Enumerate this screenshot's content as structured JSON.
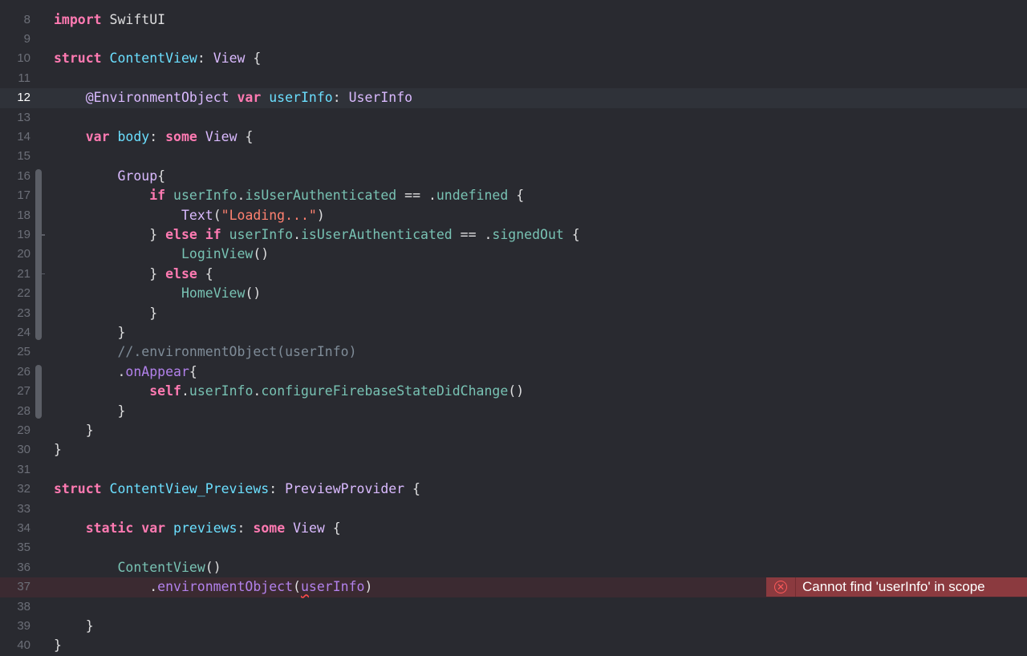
{
  "editor": {
    "language": "Swift",
    "colors": {
      "background": "#292a30",
      "current_line": "#2f3239",
      "error_line": "#3b2a31",
      "keyword": "#ff7ab2",
      "type": "#dabaff",
      "declaration": "#6bdfff",
      "property": "#78c2b3",
      "function": "#b281eb",
      "string": "#ff8170",
      "comment": "#7f8c98",
      "plain": "#dfdfe0",
      "error_badge": "#8b3a3f"
    },
    "top_partial_line_number": "7",
    "current_line_number": "12",
    "lines": [
      {
        "n": "8",
        "tokens": [
          {
            "t": "import",
            "c": "kw"
          },
          {
            "t": " SwiftUI",
            "c": ""
          }
        ]
      },
      {
        "n": "9",
        "tokens": []
      },
      {
        "n": "10",
        "tokens": [
          {
            "t": "struct",
            "c": "kw"
          },
          {
            "t": " ",
            "c": ""
          },
          {
            "t": "ContentView",
            "c": "decl"
          },
          {
            "t": ": ",
            "c": ""
          },
          {
            "t": "View",
            "c": "type"
          },
          {
            "t": " {",
            "c": ""
          }
        ]
      },
      {
        "n": "11",
        "tokens": []
      },
      {
        "n": "12",
        "tokens": [
          {
            "t": "    ",
            "c": ""
          },
          {
            "t": "@EnvironmentObject",
            "c": "type"
          },
          {
            "t": " ",
            "c": ""
          },
          {
            "t": "var",
            "c": "kw"
          },
          {
            "t": " ",
            "c": ""
          },
          {
            "t": "userInfo",
            "c": "decl"
          },
          {
            "t": ": ",
            "c": ""
          },
          {
            "t": "UserInfo",
            "c": "type"
          }
        ]
      },
      {
        "n": "13",
        "tokens": []
      },
      {
        "n": "14",
        "tokens": [
          {
            "t": "    ",
            "c": ""
          },
          {
            "t": "var",
            "c": "kw"
          },
          {
            "t": " ",
            "c": ""
          },
          {
            "t": "body",
            "c": "decl"
          },
          {
            "t": ": ",
            "c": ""
          },
          {
            "t": "some",
            "c": "kw"
          },
          {
            "t": " ",
            "c": ""
          },
          {
            "t": "View",
            "c": "type"
          },
          {
            "t": " {",
            "c": ""
          }
        ]
      },
      {
        "n": "15",
        "tokens": []
      },
      {
        "n": "16",
        "tokens": [
          {
            "t": "        ",
            "c": ""
          },
          {
            "t": "Group",
            "c": "type"
          },
          {
            "t": "{",
            "c": ""
          }
        ]
      },
      {
        "n": "17",
        "tokens": [
          {
            "t": "            ",
            "c": ""
          },
          {
            "t": "if",
            "c": "kw"
          },
          {
            "t": " ",
            "c": ""
          },
          {
            "t": "userInfo",
            "c": "prop"
          },
          {
            "t": ".",
            "c": ""
          },
          {
            "t": "isUserAuthenticated",
            "c": "prop"
          },
          {
            "t": " == .",
            "c": ""
          },
          {
            "t": "undefined",
            "c": "prop"
          },
          {
            "t": " {",
            "c": ""
          }
        ]
      },
      {
        "n": "18",
        "tokens": [
          {
            "t": "                ",
            "c": ""
          },
          {
            "t": "Text",
            "c": "type"
          },
          {
            "t": "(",
            "c": ""
          },
          {
            "t": "\"Loading...\"",
            "c": "str"
          },
          {
            "t": ")",
            "c": ""
          }
        ]
      },
      {
        "n": "19",
        "tokens": [
          {
            "t": "            } ",
            "c": ""
          },
          {
            "t": "else",
            "c": "kw"
          },
          {
            "t": " ",
            "c": ""
          },
          {
            "t": "if",
            "c": "kw"
          },
          {
            "t": " ",
            "c": ""
          },
          {
            "t": "userInfo",
            "c": "prop"
          },
          {
            "t": ".",
            "c": ""
          },
          {
            "t": "isUserAuthenticated",
            "c": "prop"
          },
          {
            "t": " == .",
            "c": ""
          },
          {
            "t": "signedOut",
            "c": "prop"
          },
          {
            "t": " {",
            "c": ""
          }
        ]
      },
      {
        "n": "20",
        "tokens": [
          {
            "t": "                ",
            "c": ""
          },
          {
            "t": "LoginView",
            "c": "prop"
          },
          {
            "t": "()",
            "c": ""
          }
        ]
      },
      {
        "n": "21",
        "tokens": [
          {
            "t": "            } ",
            "c": ""
          },
          {
            "t": "else",
            "c": "kw"
          },
          {
            "t": " {",
            "c": ""
          }
        ]
      },
      {
        "n": "22",
        "tokens": [
          {
            "t": "                ",
            "c": ""
          },
          {
            "t": "HomeView",
            "c": "prop"
          },
          {
            "t": "()",
            "c": ""
          }
        ]
      },
      {
        "n": "23",
        "tokens": [
          {
            "t": "            }",
            "c": ""
          }
        ]
      },
      {
        "n": "24",
        "tokens": [
          {
            "t": "        }",
            "c": ""
          }
        ]
      },
      {
        "n": "25",
        "tokens": [
          {
            "t": "        ",
            "c": ""
          },
          {
            "t": "//.environmentObject(userInfo)",
            "c": "cmt"
          }
        ]
      },
      {
        "n": "26",
        "tokens": [
          {
            "t": "        .",
            "c": ""
          },
          {
            "t": "onAppear",
            "c": "fn"
          },
          {
            "t": "{",
            "c": ""
          }
        ]
      },
      {
        "n": "27",
        "tokens": [
          {
            "t": "            ",
            "c": ""
          },
          {
            "t": "self",
            "c": "kw"
          },
          {
            "t": ".",
            "c": ""
          },
          {
            "t": "userInfo",
            "c": "prop"
          },
          {
            "t": ".",
            "c": ""
          },
          {
            "t": "configureFirebaseStateDidChange",
            "c": "prop"
          },
          {
            "t": "()",
            "c": ""
          }
        ]
      },
      {
        "n": "28",
        "tokens": [
          {
            "t": "        }",
            "c": ""
          }
        ]
      },
      {
        "n": "29",
        "tokens": [
          {
            "t": "    }",
            "c": ""
          }
        ]
      },
      {
        "n": "30",
        "tokens": [
          {
            "t": "}",
            "c": ""
          }
        ]
      },
      {
        "n": "31",
        "tokens": []
      },
      {
        "n": "32",
        "tokens": [
          {
            "t": "struct",
            "c": "kw"
          },
          {
            "t": " ",
            "c": ""
          },
          {
            "t": "ContentView_Previews",
            "c": "decl"
          },
          {
            "t": ": ",
            "c": ""
          },
          {
            "t": "PreviewProvider",
            "c": "type"
          },
          {
            "t": " {",
            "c": ""
          }
        ]
      },
      {
        "n": "33",
        "tokens": []
      },
      {
        "n": "34",
        "tokens": [
          {
            "t": "    ",
            "c": ""
          },
          {
            "t": "static",
            "c": "kw"
          },
          {
            "t": " ",
            "c": ""
          },
          {
            "t": "var",
            "c": "kw"
          },
          {
            "t": " ",
            "c": ""
          },
          {
            "t": "previews",
            "c": "decl"
          },
          {
            "t": ": ",
            "c": ""
          },
          {
            "t": "some",
            "c": "kw"
          },
          {
            "t": " ",
            "c": ""
          },
          {
            "t": "View",
            "c": "type"
          },
          {
            "t": " {",
            "c": ""
          }
        ]
      },
      {
        "n": "35",
        "tokens": []
      },
      {
        "n": "36",
        "tokens": [
          {
            "t": "        ",
            "c": ""
          },
          {
            "t": "ContentView",
            "c": "prop"
          },
          {
            "t": "()",
            "c": ""
          }
        ]
      },
      {
        "n": "37",
        "tokens": [
          {
            "t": "            .",
            "c": ""
          },
          {
            "t": "environmentObject",
            "c": "fn"
          },
          {
            "t": "(",
            "c": ""
          },
          {
            "t": "u",
            "c": "fn err-word"
          },
          {
            "t": "serInfo",
            "c": "fn"
          },
          {
            "t": ")",
            "c": ""
          }
        ]
      },
      {
        "n": "38",
        "tokens": []
      },
      {
        "n": "39",
        "tokens": [
          {
            "t": "    }",
            "c": ""
          }
        ]
      },
      {
        "n": "40",
        "tokens": [
          {
            "t": "}",
            "c": ""
          }
        ]
      }
    ]
  },
  "error": {
    "line_number": "37",
    "icon": "x-circle-icon",
    "icon_glyph": "✕",
    "message": "Cannot find 'userInfo' in scope"
  }
}
